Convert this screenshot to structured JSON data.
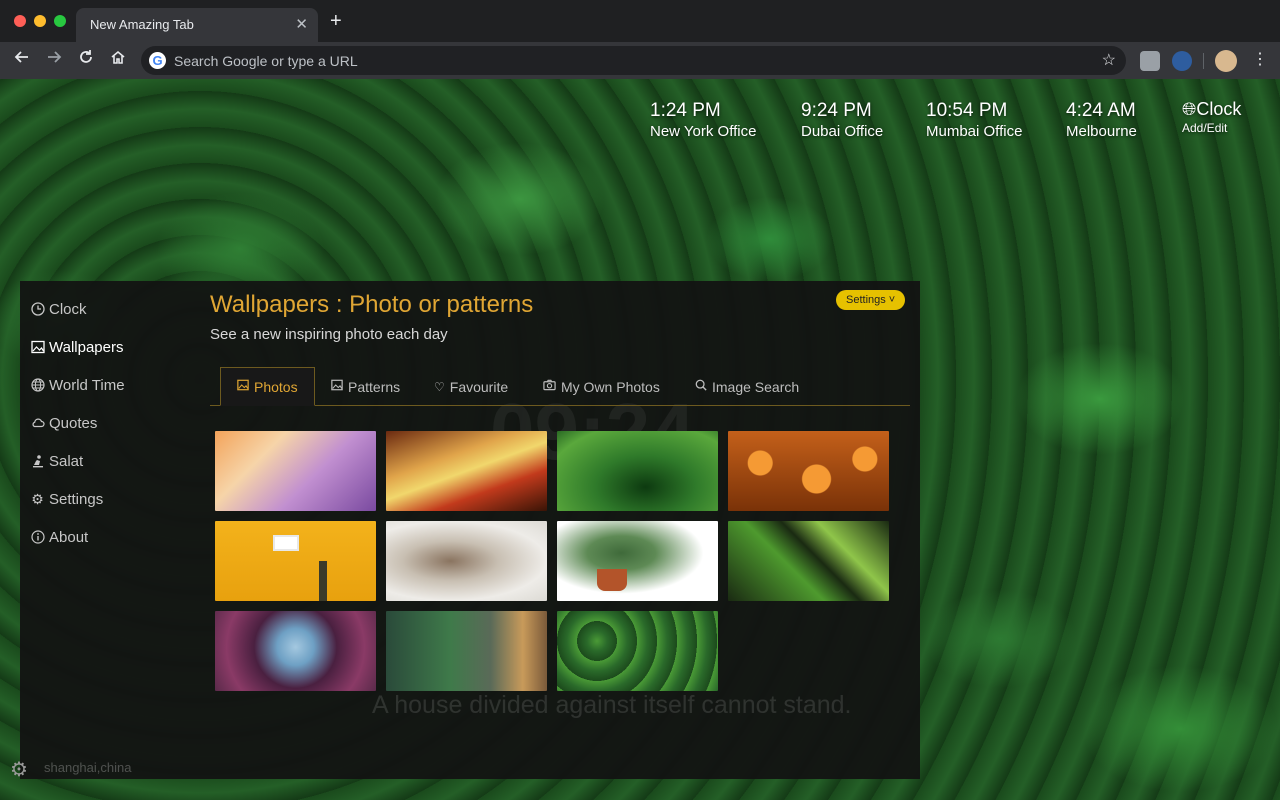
{
  "browser": {
    "tab_title": "New Amazing Tab",
    "tab_close": "✕",
    "new_tab": "+",
    "omnibox_placeholder": "Search Google or type a URL",
    "google_logo": "G",
    "icons": {
      "back": "arrow-left-icon",
      "forward": "arrow-right-icon",
      "reload": "reload-icon",
      "home": "home-icon",
      "star": "star-icon",
      "menu": "kebab-menu-icon"
    }
  },
  "clocks": [
    {
      "time": "1:24 PM",
      "city": "New York Office"
    },
    {
      "time": "9:24 PM",
      "city": "Dubai Office"
    },
    {
      "time": "10:54 PM",
      "city": "Mumbai Office"
    },
    {
      "time": "4:24 AM",
      "city": "Melbourne"
    }
  ],
  "clock_widget": {
    "title": "Clock",
    "subtitle": "Add/Edit"
  },
  "sidebar": {
    "items": [
      {
        "label": "Clock",
        "icon": "clock-icon"
      },
      {
        "label": "Wallpapers",
        "icon": "image-icon"
      },
      {
        "label": "World Time",
        "icon": "globe-icon"
      },
      {
        "label": "Quotes",
        "icon": "cloud-icon"
      },
      {
        "label": "Salat",
        "icon": "prayer-icon"
      },
      {
        "label": "Settings",
        "icon": "gear-icon"
      },
      {
        "label": "About",
        "icon": "info-icon"
      }
    ],
    "active": "Wallpapers"
  },
  "main": {
    "title": "Wallpapers : Photo or patterns",
    "subtitle": "See a new inspiring photo each day",
    "settings_button": "Settings ˅",
    "tabs": [
      {
        "label": "Photos",
        "icon": "image-icon"
      },
      {
        "label": "Patterns",
        "icon": "image-icon"
      },
      {
        "label": "Favourite",
        "icon": "heart-icon"
      },
      {
        "label": "My Own Photos",
        "icon": "camera-icon"
      },
      {
        "label": "Image Search",
        "icon": "search-icon"
      }
    ],
    "active_tab": "Photos",
    "thumbnails": [
      {
        "subject": "low-poly abstract",
        "colors": [
          "#f3a35a",
          "#b77ac0",
          "#7a4aa0"
        ]
      },
      {
        "subject": "rangoli colors",
        "colors": [
          "#d7a34a",
          "#7a2d14",
          "#f0d86a"
        ]
      },
      {
        "subject": "agave leaves",
        "colors": [
          "#2f7a2a",
          "#5aa83c",
          "#0d3a10"
        ]
      },
      {
        "subject": "pumpkins",
        "colors": [
          "#e07a1e",
          "#f59a34",
          "#7a3208"
        ]
      },
      {
        "subject": "yellow wall lamp",
        "colors": [
          "#f3b21b",
          "#ffffff",
          "#e8a10e"
        ]
      },
      {
        "subject": "cat",
        "colors": [
          "#dcdad4",
          "#8a7460",
          "#f4f2ee"
        ]
      },
      {
        "subject": "potted plant",
        "colors": [
          "#ffffff",
          "#3f6a3a",
          "#b3542a"
        ]
      },
      {
        "subject": "spider plant",
        "colors": [
          "#1a2a12",
          "#4e9a2e",
          "#8fc54a"
        ]
      },
      {
        "subject": "succulent",
        "colors": [
          "#8a3a66",
          "#6ea0c4",
          "#4a2040"
        ]
      },
      {
        "subject": "indoor plants",
        "colors": [
          "#2a4a3a",
          "#3f7a4a",
          "#c89a5a"
        ]
      },
      {
        "subject": "green foliage",
        "colors": [
          "#1c4a1c",
          "#4a9a36",
          "#2a6a2a"
        ]
      }
    ]
  },
  "quote": "A house divided against itself cannot stand.",
  "background_clock": "09:24",
  "location": "shanghai,china"
}
